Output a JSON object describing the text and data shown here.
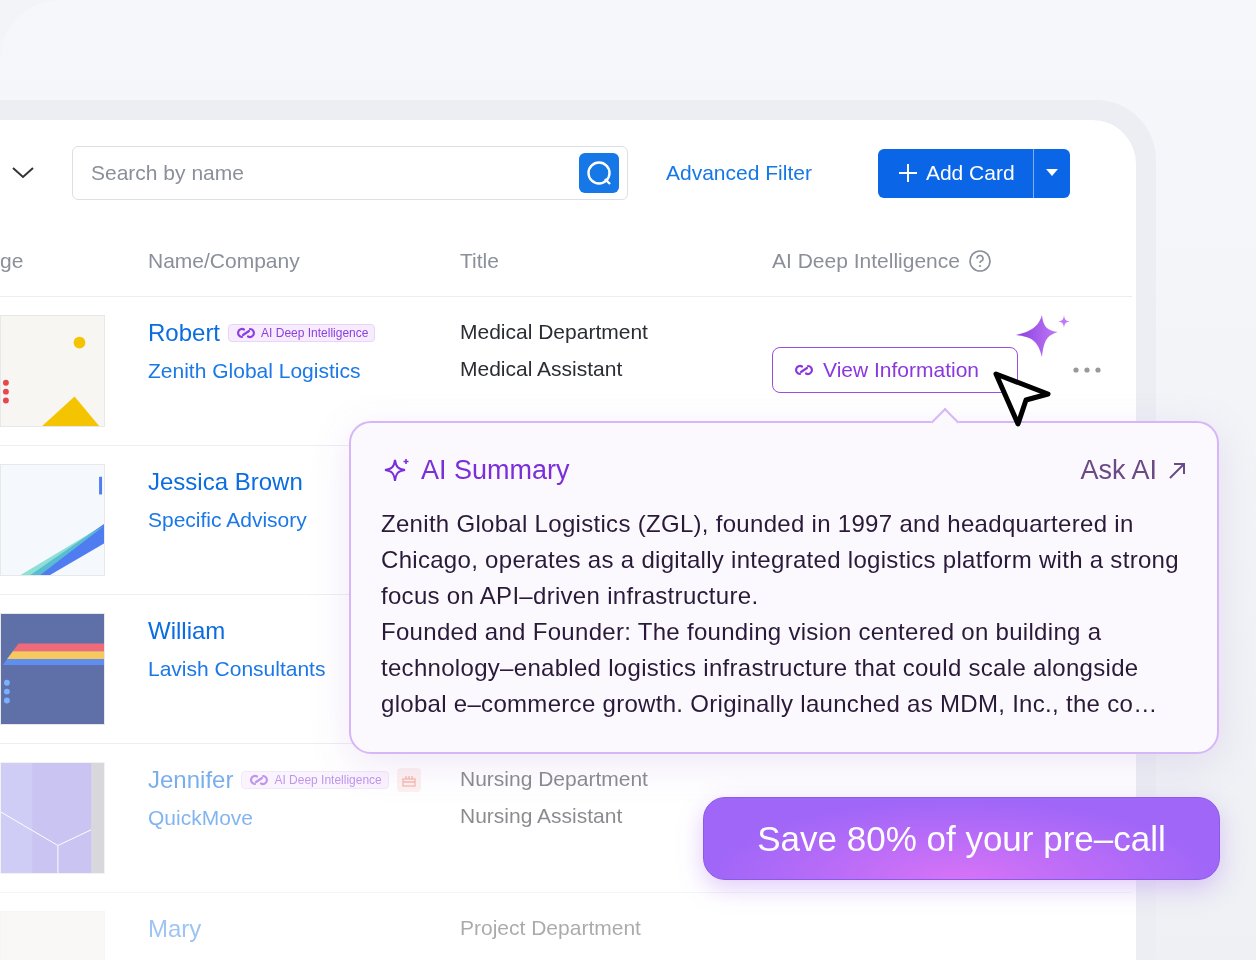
{
  "toolbar": {
    "search": {
      "placeholder": "Search by name"
    },
    "advanced_filter": "Advanced Filter",
    "add_card": "Add Card"
  },
  "table": {
    "columns": [
      "ge",
      "Name/Company",
      "Title",
      "AI Deep Intelligence"
    ],
    "rows": [
      {
        "name": "Robert",
        "badge": "AI Deep Intelligence",
        "company": "Zenith Global Logistics",
        "department": "Medical Department",
        "position": "Medical Assistant",
        "action": "View Information",
        "birthday": false
      },
      {
        "name": "Jessica Brown",
        "company": "Specific Advisory",
        "birthday": false
      },
      {
        "name": "William",
        "company": "Lavish Consultants",
        "birthday": false
      },
      {
        "name": "Jennifer",
        "badge": "AI Deep Intelligence",
        "company": "QuickMove",
        "department": "Nursing Department",
        "position": "Nursing Assistant",
        "birthday": true
      },
      {
        "name": "Mary",
        "department": "Project Department",
        "birthday": false
      }
    ]
  },
  "ai_summary": {
    "title": "AI Summary",
    "ask": "Ask AI",
    "paragraphs": [
      "Zenith Global Logistics (ZGL), founded in 1997 and headquartered in Chicago, operates as a digitally integrated logistics platform with a strong focus on API–driven infrastructure.",
      "Founded and Founder: The founding vision centered on building a technology–enabled logistics infrastructure that could scale alongside global e–commerce growth. Originally launched as MDM, Inc., the co…"
    ]
  },
  "banner": "Save 80% of your pre–call"
}
